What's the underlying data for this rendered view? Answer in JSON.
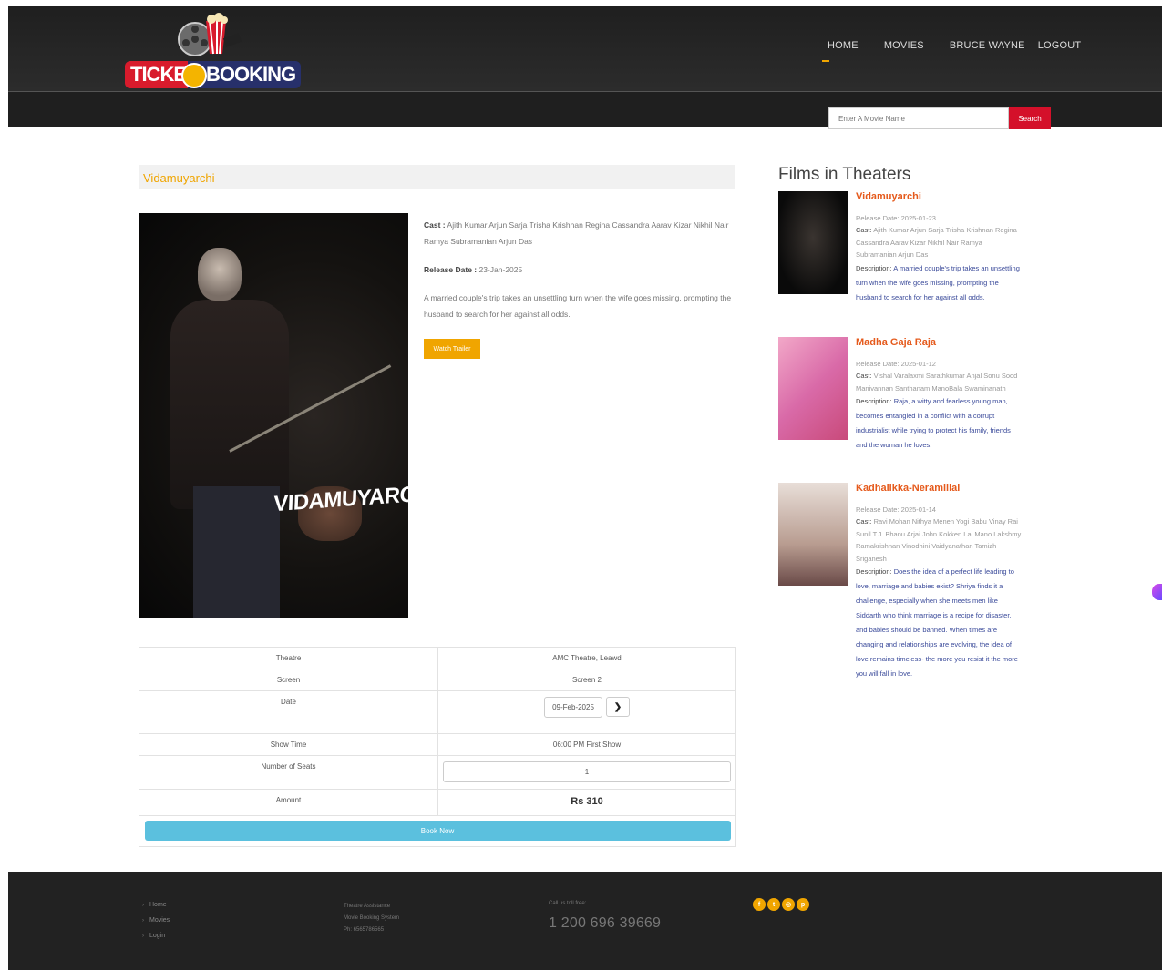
{
  "brand": {
    "logo_text_left": "TICKE",
    "logo_text_right": "BOOKING"
  },
  "nav": {
    "items": [
      "HOME",
      "MOVIES",
      "BRUCE WAYNE",
      "LOGOUT"
    ]
  },
  "search": {
    "placeholder": "Enter A Movie Name",
    "button": "Search"
  },
  "movie": {
    "title": "Vidamuyarchi",
    "poster_title": "VIDAMUYARCHI",
    "cast_label": "Cast :",
    "cast": "Ajith Kumar Arjun Sarja Trisha Krishnan Regina Cassandra Aarav Kizar Nikhil Nair Ramya Subramanian Arjun Das",
    "release_label": "Release Date :",
    "release": "23-Jan-2025",
    "description": "A married couple's trip takes an unsettling turn when the wife goes missing, prompting the husband to search for her against all odds.",
    "trailer_button": "Watch Trailer"
  },
  "booking": {
    "theatre_label": "Theatre",
    "theatre": "AMC Theatre, Leawd",
    "screen_label": "Screen",
    "screen": "Screen 2",
    "date_label": "Date",
    "date": "09-Feb-2025",
    "showtime_label": "Show Time",
    "showtime": "06:00 PM First Show",
    "seats_label": "Number of Seats",
    "seats": "1",
    "amount_label": "Amount",
    "amount": "Rs 310",
    "book_button": "Book Now"
  },
  "sidebar": {
    "title": "Films in Theaters",
    "films": [
      {
        "name": "Vidamuyarchi",
        "release": "Release Date: 2025-01-23",
        "cast_label": "Cast:",
        "cast": "Ajith Kumar Arjun Sarja Trisha Krishnan Regina Cassandra Aarav Kizar Nikhil Nair Ramya Subramanian Arjun Das",
        "desc_label": "Description:",
        "desc": "A married couple's trip takes an unsettling turn when the wife goes missing, prompting the husband to search for her against all odds."
      },
      {
        "name": "Madha Gaja Raja",
        "release": "Release Date: 2025-01-12",
        "cast_label": "Cast:",
        "cast": "Vishal Varalaxmi Sarathkumar Anjal Sonu Sood Manivannan Santhanam ManoBala Swaminanath",
        "desc_label": "Description:",
        "desc": "Raja, a witty and fearless young man, becomes entangled in a conflict with a corrupt industrialist while trying to protect his family, friends and the woman he loves."
      },
      {
        "name": "Kadhalikka-Neramillai",
        "release": "Release Date: 2025-01-14",
        "cast_label": "Cast:",
        "cast": "Ravi Mohan Nithya Menen Yogi Babu Vinay Rai Sunil T.J. Bhanu Arjai John Kokken Lal Mano Lakshmy Ramakrishnan Vinodhini Vaidyanathan Tamizh Sriganesh",
        "desc_label": "Description:",
        "desc": "Does the idea of a perfect life leading to love, marriage and babies exist? Shriya finds it a challenge, especially when she meets men like Siddarth who think marriage is a recipe for disaster, and babies should be banned. When times are changing and relationships are evolving, the idea of love remains timeless- the more you resist it the more you will fall in love."
      }
    ]
  },
  "footer": {
    "links": [
      "Home",
      "Movies",
      "Login"
    ],
    "about": [
      "Theatre Assistance",
      "Movie Booking System",
      "Ph: 6565786565"
    ],
    "call_label": "Call us toll free:",
    "phone": "1 200 696 39669",
    "socials": [
      "facebook-icon",
      "twitter-icon",
      "dribbble-icon",
      "pinterest-icon"
    ]
  },
  "colors": {
    "accent": "#f0a500",
    "search_button": "#d4102a",
    "book_button": "#5bc0de",
    "film_name": "#e55a1c"
  }
}
